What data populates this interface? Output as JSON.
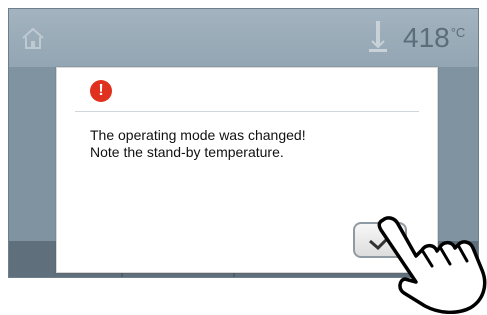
{
  "status_bar": {
    "home_icon": "home-icon",
    "thermometer_icon": "thermometer-icon",
    "temperature_value": "418",
    "temperature_unit": "°C"
  },
  "dialog": {
    "alert_icon_symbol": "!",
    "message_line1": "The operating mode was changed!",
    "message_line2": "Note the stand-by temperature.",
    "confirm_icon": "checkmark-icon"
  },
  "colors": {
    "alert": "#e0301e",
    "screen": "#7f93a1"
  }
}
